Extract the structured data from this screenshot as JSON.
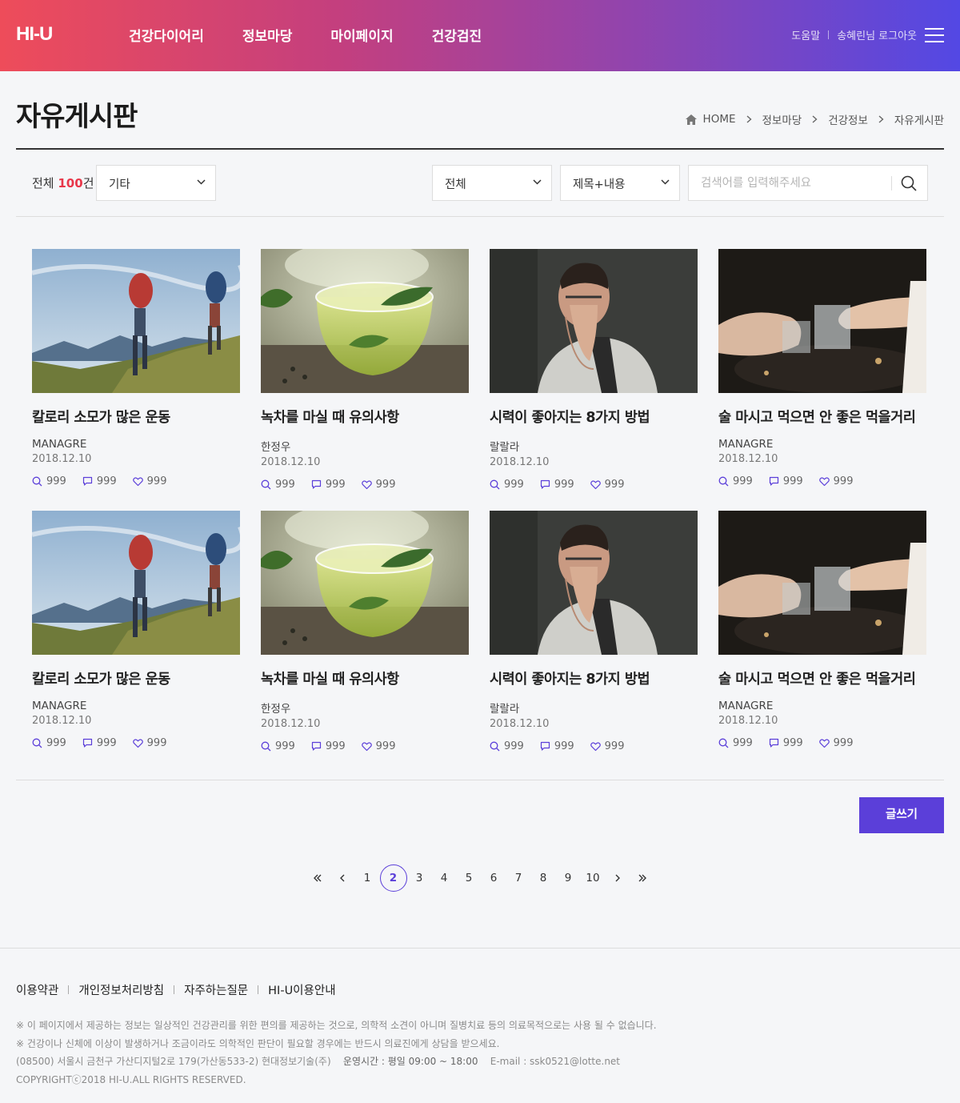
{
  "header": {
    "logo": "HI-U",
    "nav": [
      "건강다이어리",
      "정보마당",
      "마이페이지",
      "건강검진"
    ],
    "help": "도움말",
    "user_logout": "송혜린님 로그아웃"
  },
  "page": {
    "title": "자유게시판",
    "breadcrumb": [
      "HOME",
      "정보마당",
      "건강정보",
      "자유게시판"
    ]
  },
  "filter": {
    "total_prefix": "전체 ",
    "total_count": "100",
    "total_suffix": "건",
    "category_select": "기타",
    "scope_select": "전체",
    "field_select": "제목+내용",
    "search_placeholder": "검색어를 입력해주세요"
  },
  "posts": [
    {
      "title": "칼로리 소모가 많은 운동",
      "author": "MANAGRE",
      "date": "2018.12.10",
      "views": "999",
      "comments": "999",
      "likes": "999",
      "image": "hikers"
    },
    {
      "title": "녹차를 마실 때 유의사항",
      "author": "한정우",
      "date": "2018.12.10",
      "views": "999",
      "comments": "999",
      "likes": "999",
      "image": "green-tea"
    },
    {
      "title": "시력이 좋아지는 8가지 방법",
      "author": "랄랄라",
      "date": "2018.12.10",
      "views": "999",
      "comments": "999",
      "likes": "999",
      "image": "tired-man"
    },
    {
      "title": "술 마시고 먹으면 안 좋은 먹을거리",
      "author": "MANAGRE",
      "date": "2018.12.10",
      "views": "999",
      "comments": "999",
      "likes": "999",
      "image": "toasting-glasses"
    },
    {
      "title": "칼로리 소모가 많은 운동",
      "author": "MANAGRE",
      "date": "2018.12.10",
      "views": "999",
      "comments": "999",
      "likes": "999",
      "image": "hikers"
    },
    {
      "title": "녹차를 마실 때 유의사항",
      "author": "한정우",
      "date": "2018.12.10",
      "views": "999",
      "comments": "999",
      "likes": "999",
      "image": "green-tea"
    },
    {
      "title": "시력이 좋아지는 8가지 방법",
      "author": "랄랄라",
      "date": "2018.12.10",
      "views": "999",
      "comments": "999",
      "likes": "999",
      "image": "tired-man"
    },
    {
      "title": "술 마시고 먹으면 안 좋은 먹을거리",
      "author": "MANAGRE",
      "date": "2018.12.10",
      "views": "999",
      "comments": "999",
      "likes": "999",
      "image": "toasting-glasses"
    }
  ],
  "write_button": "글쓰기",
  "pagination": {
    "pages": [
      "1",
      "2",
      "3",
      "4",
      "5",
      "6",
      "7",
      "8",
      "9",
      "10"
    ],
    "current": "2"
  },
  "footer": {
    "links": [
      "이용약관",
      "개인정보처리방침",
      "자주하는질문",
      "HI-U이용안내"
    ],
    "notice1": "※ 이 페이지에서 제공하는 정보는 일상적인 건강관리를 위한 편의를 제공하는 것으로, 의학적 소견이 아니며 질병치료 등의 의료목적으로는 사용 될 수 없습니다.",
    "notice2": "※ 건강이나 신체에 이상이 발생하거나 조금이라도 의학적인 판단이 필요할 경우에는 반드시 의료진에게 상담을 받으세요.",
    "address": "(08500) 서울시 금천구 가산디지털2로 179(가산동533-2) 현대정보기술(주)",
    "hours": "운영시간 : 평일 09:00 ~ 18:00",
    "email": "E-mail : ssk0521@lotte.net",
    "copyright": "COPYRIGHTⓒ2018 HI-U.ALL RIGHTS RESERVED."
  },
  "colors": {
    "accent": "#5b3fd9",
    "count_red": "#e8374a",
    "header_gradient_start": "#ee4c5a",
    "header_gradient_end": "#5348e4"
  }
}
